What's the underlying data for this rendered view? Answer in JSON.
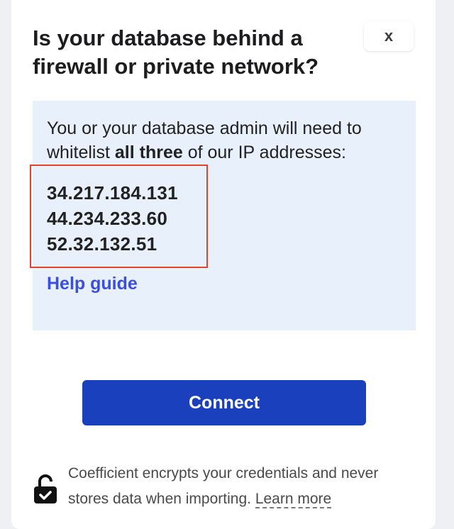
{
  "dialog": {
    "title": "Is your database behind a firewall or private network?",
    "close_label": "x"
  },
  "info": {
    "text_before": "You or your database admin will need to whitelist ",
    "text_bold": "all three",
    "text_after": " of our IP addresses:",
    "ip_addresses": [
      "34.217.184.131",
      "44.234.233.60",
      "52.32.132.51"
    ],
    "highlight_color": "#e0452b",
    "box_color": "#e7f0fb",
    "help_link_label": "Help guide",
    "link_color": "#3a4fe0"
  },
  "actions": {
    "connect_label": "Connect",
    "connect_color": "#1a40bd"
  },
  "footer": {
    "icon": "lock-icon",
    "text": "Coefficient encrypts your credentials and never stores data when importing. ",
    "learn_more_label": "Learn more"
  }
}
